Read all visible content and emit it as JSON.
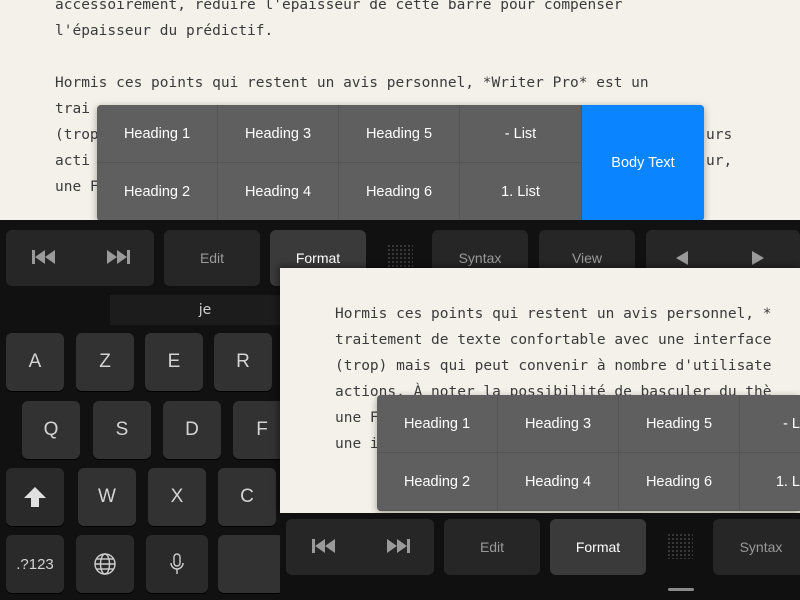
{
  "document": {
    "lines_back": [
      "accessoirement, réduire l'épaisseur de cette barre pour compenser",
      "l'épaisseur du prédictif.",
      "",
      "Hormis ces points qui restent un avis personnel, *Writer Pro* est un",
      "trai",
      "(trop",
      "acti",
      "une F"
    ],
    "back_right_fragments": [
      "urs",
      "ur,"
    ],
    "lines_front": [
      "Hormis ces points qui restent un avis personnel, *",
      "traitement de texte confortable avec une interface",
      "(trop) mais qui peut convenir à nombre d'utilisate",
      "actions. À noter la possibilité de basculer du thè",
      "une F",
      "une i"
    ]
  },
  "format_popup": {
    "row1": [
      "Heading 1",
      "Heading 3",
      "Heading 5",
      "- List"
    ],
    "row2": [
      "Heading 2",
      "Heading 4",
      "Heading 6",
      "1. List"
    ],
    "body_text": "Body Text"
  },
  "format_popup_front": {
    "row1": [
      "Heading 1",
      "Heading 3",
      "Heading 5",
      "- L"
    ],
    "row2": [
      "Heading 2",
      "Heading 4",
      "Heading 6",
      "1. L"
    ]
  },
  "toolbar": {
    "edit": "Edit",
    "format": "Format",
    "syntax": "Syntax",
    "view": "View"
  },
  "prediction": {
    "word": "je"
  },
  "keyboard": {
    "row1": [
      "A",
      "Z",
      "E",
      "R"
    ],
    "row2": [
      "Q",
      "S",
      "D",
      "F"
    ],
    "row3": [
      "W",
      "X",
      "C"
    ],
    "numbers_key": ".?123"
  },
  "icons": {
    "rewind": "rewind-icon",
    "fast_forward": "fast-forward-icon",
    "arrow_left": "arrow-left-icon",
    "arrow_right": "arrow-right-icon",
    "shift": "shift-icon",
    "globe": "globe-icon",
    "mic": "microphone-icon"
  },
  "colors": {
    "paper": "#f4f1ea",
    "popup": "#5f5f5f",
    "accent": "#0a84ff",
    "keyboard_bg": "#111111"
  }
}
